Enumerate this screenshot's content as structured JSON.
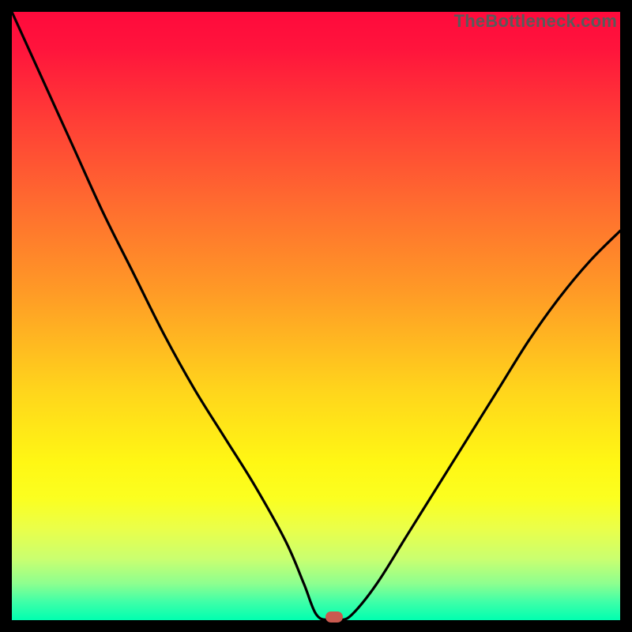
{
  "watermark": "TheBottleneck.com",
  "chart_data": {
    "type": "line",
    "title": "",
    "xlabel": "",
    "ylabel": "",
    "xlim": [
      0,
      100
    ],
    "ylim": [
      0,
      100
    ],
    "grid": false,
    "series": [
      {
        "name": "bottleneck-curve",
        "x": [
          0,
          5,
          10,
          15,
          20,
          25,
          30,
          35,
          40,
          45,
          48,
          50,
          52,
          54,
          56,
          60,
          65,
          70,
          75,
          80,
          85,
          90,
          95,
          100
        ],
        "y": [
          100,
          89,
          78,
          67,
          57,
          47,
          38,
          30,
          22,
          13,
          6,
          1,
          0,
          0,
          1,
          6,
          14,
          22,
          30,
          38,
          46,
          53,
          59,
          64
        ]
      }
    ],
    "marker": {
      "x": 53,
      "y": 0.5
    },
    "background_gradient": {
      "top": "#ff0a3c",
      "mid": "#fff714",
      "bottom": "#00ffb0"
    }
  }
}
